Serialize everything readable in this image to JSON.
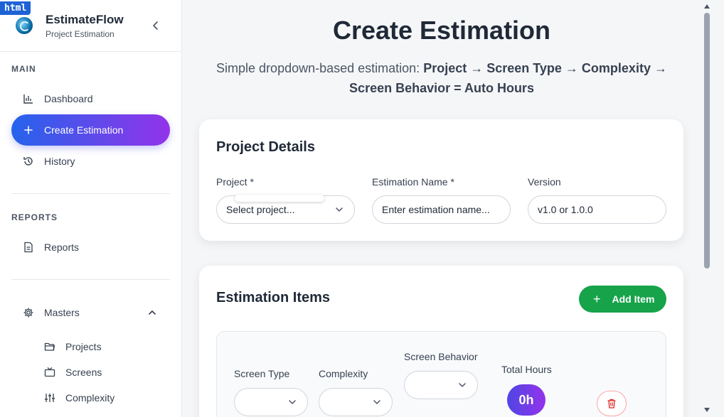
{
  "badge": "html",
  "brand": {
    "title": "EstimateFlow",
    "subtitle": "Project Estimation"
  },
  "sidebar": {
    "main_label": "MAIN",
    "items": [
      {
        "label": "Dashboard",
        "icon": "bar-chart-icon"
      },
      {
        "label": "Create Estimation",
        "icon": "plus-icon",
        "active": true
      },
      {
        "label": "History",
        "icon": "history-icon"
      }
    ],
    "reports_label": "REPORTS",
    "reports_items": [
      {
        "label": "Reports",
        "icon": "document-icon"
      }
    ],
    "masters": {
      "label": "Masters",
      "icon": "gear-icon",
      "expanded": true
    },
    "masters_items": [
      {
        "label": "Projects",
        "icon": "folder-icon"
      },
      {
        "label": "Screens",
        "icon": "tv-icon"
      },
      {
        "label": "Complexity",
        "icon": "sliders-icon"
      }
    ]
  },
  "main": {
    "title": "Create Estimation",
    "subtitle_intro": "Simple dropdown-based estimation: ",
    "subtitle_flow": "Project → Screen Type → Complexity → Screen Behavior = Auto Hours",
    "project_details": {
      "title": "Project Details",
      "project_label": "Project *",
      "project_value": "Select project...",
      "estimation_name_label": "Estimation Name *",
      "estimation_name_placeholder": "Enter estimation name...",
      "version_label": "Version",
      "version_placeholder": "v1.0 or 1.0.0"
    },
    "estimation_items": {
      "title": "Estimation Items",
      "add_button": "Add Item",
      "screen_type_label": "Screen Type",
      "complexity_label": "Complexity",
      "screen_behavior_label": "Screen Behavior",
      "total_hours_label": "Total Hours",
      "total_hours_value": "0h"
    }
  },
  "colors": {
    "primary_gradient_start": "#2563eb",
    "primary_gradient_end": "#9333ea",
    "success": "#16a34a",
    "danger": "#dc2626"
  }
}
